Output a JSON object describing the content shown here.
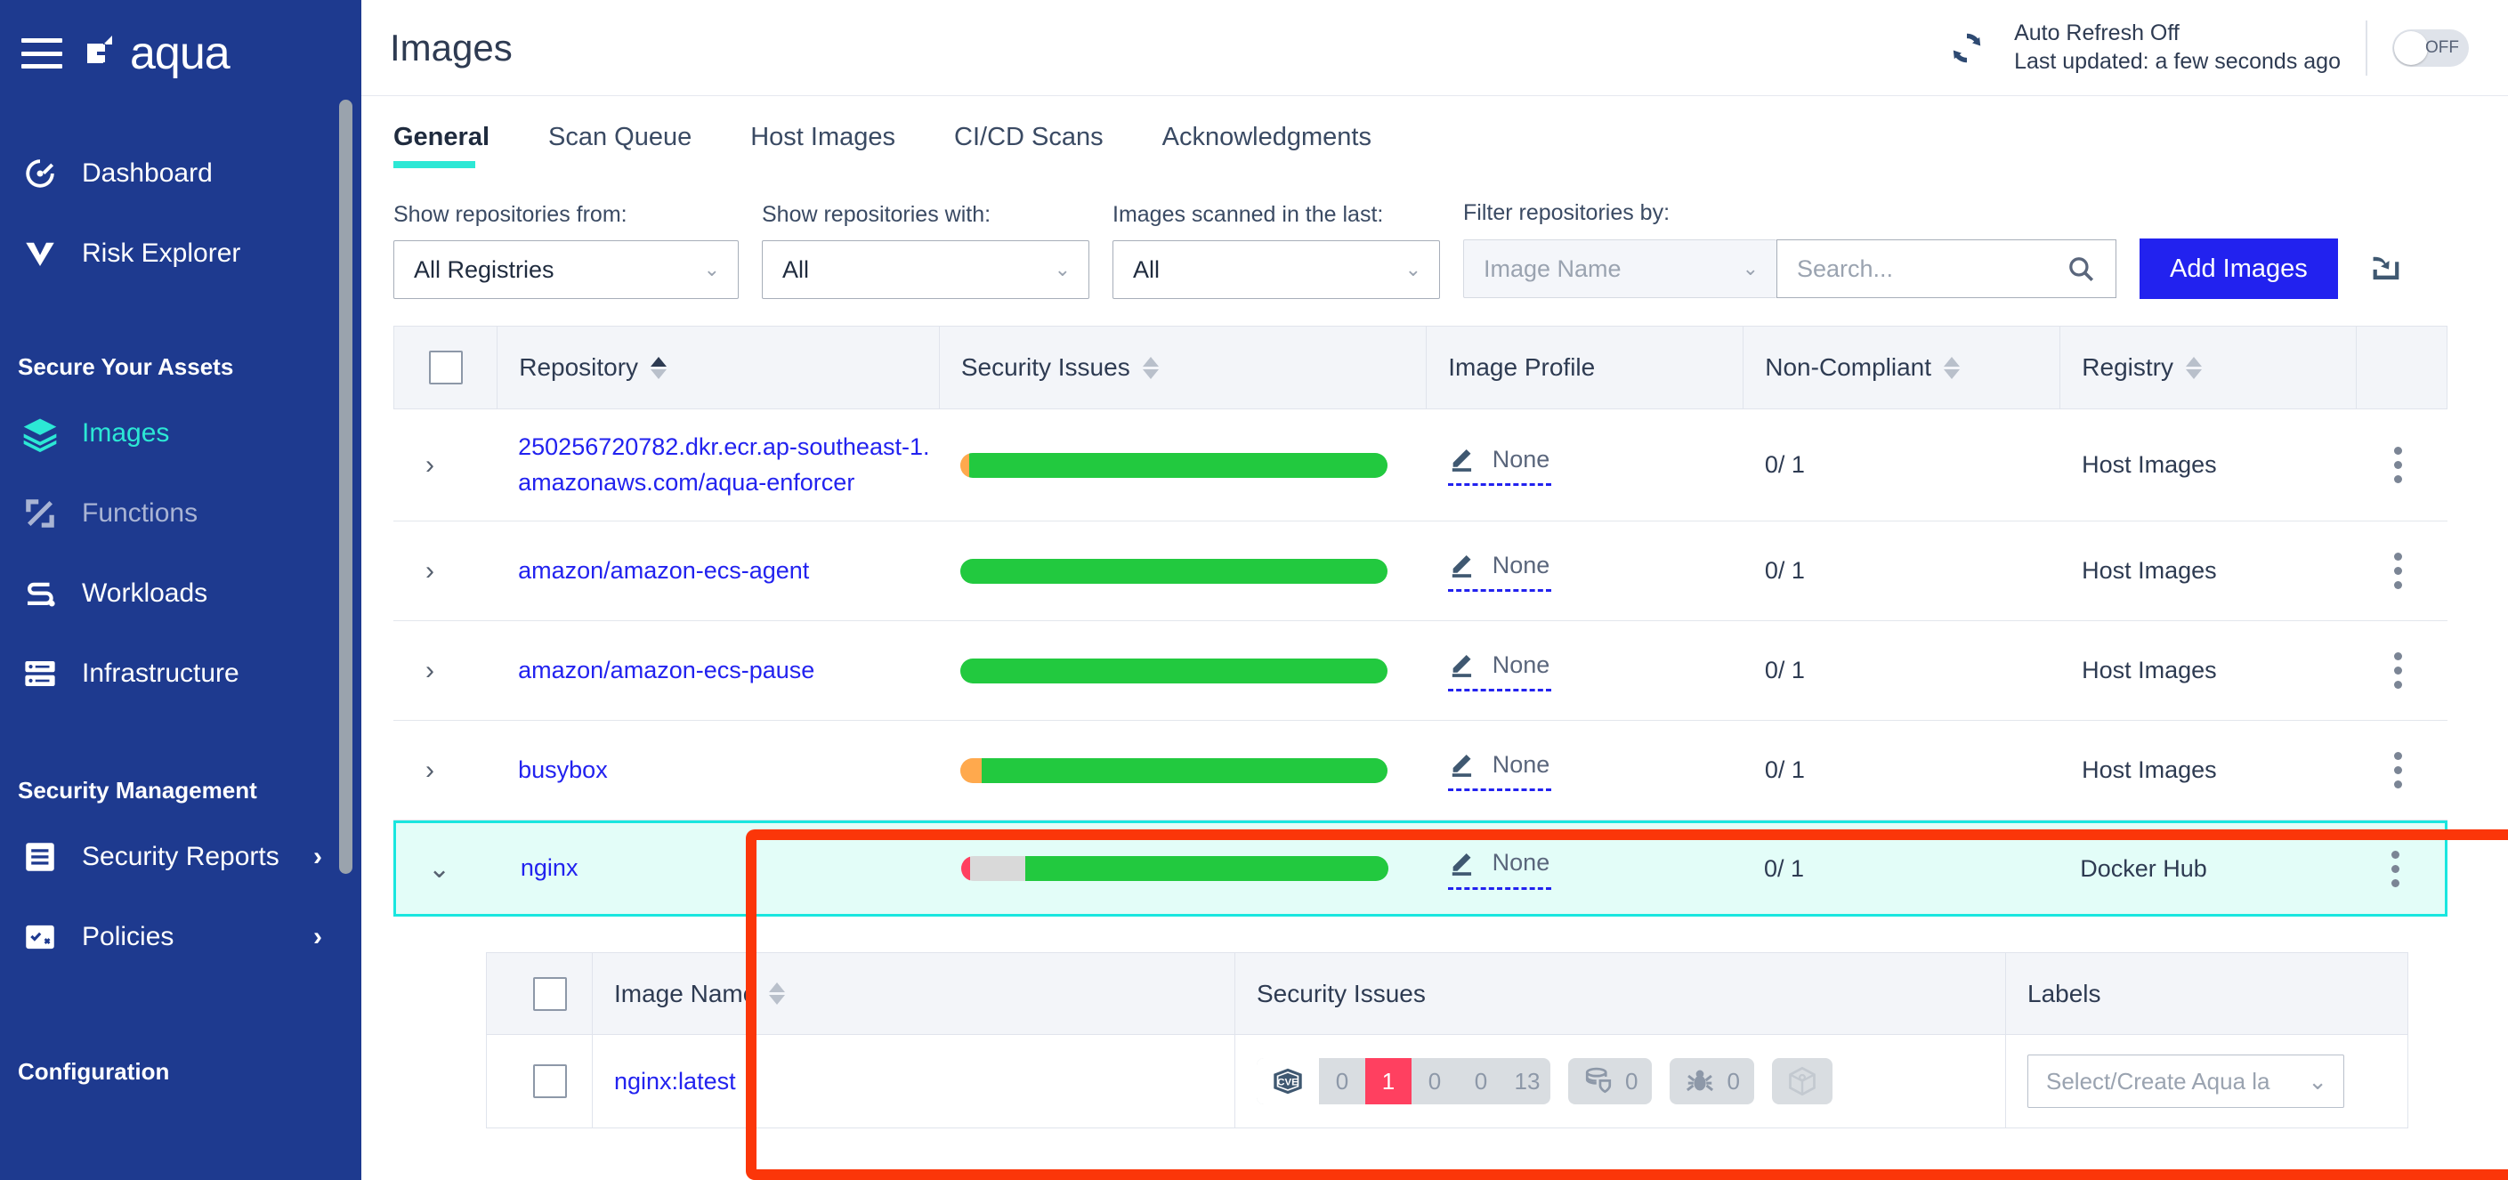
{
  "sidebar": {
    "brand": "aqua",
    "items": [
      {
        "label": "Dashboard",
        "icon": "dashboard-icon",
        "state": "normal"
      },
      {
        "label": "Risk Explorer",
        "icon": "risk-explorer-icon",
        "state": "normal"
      }
    ],
    "section_assets": "Secure Your Assets",
    "assets_items": [
      {
        "label": "Images",
        "icon": "images-icon",
        "state": "active"
      },
      {
        "label": "Functions",
        "icon": "functions-icon",
        "state": "dim"
      },
      {
        "label": "Workloads",
        "icon": "workloads-icon",
        "state": "normal"
      },
      {
        "label": "Infrastructure",
        "icon": "infrastructure-icon",
        "state": "normal"
      }
    ],
    "section_security": "Security Management",
    "security_items": [
      {
        "label": "Security Reports",
        "icon": "reports-icon",
        "chevron": "›"
      },
      {
        "label": "Policies",
        "icon": "policies-icon",
        "chevron": "›"
      }
    ],
    "section_configuration": "Configuration"
  },
  "header": {
    "title": "Images",
    "refresh_status": "Auto Refresh Off",
    "last_updated": "Last updated: a few seconds ago",
    "toggle_label": "OFF"
  },
  "tabs": [
    {
      "label": "General",
      "active": true
    },
    {
      "label": "Scan Queue",
      "active": false
    },
    {
      "label": "Host Images",
      "active": false
    },
    {
      "label": "CI/CD Scans",
      "active": false
    },
    {
      "label": "Acknowledgments",
      "active": false
    }
  ],
  "filters": {
    "registries_label": "Show repositories from:",
    "registries_value": "All Registries",
    "with_label": "Show repositories with:",
    "with_value": "All",
    "scanned_label": "Images scanned in the last:",
    "scanned_value": "All",
    "filterby_label": "Filter repositories by:",
    "filterby_value": "Image Name",
    "search_placeholder": "Search...",
    "add_images_label": "Add Images"
  },
  "table": {
    "columns": [
      "Repository",
      "Security Issues",
      "Image Profile",
      "Non-Compliant",
      "Registry"
    ],
    "rows": [
      {
        "repository": "250256720782.dkr.ecr.ap-southeast-1.amazonaws.com/aqua-enforcer",
        "profile": "None",
        "non_compliant": "0/ 1",
        "registry": "Host Images",
        "bar": [
          {
            "color": "#ffa94d",
            "pct": 2
          },
          {
            "color": "#22c93f",
            "pct": 98
          }
        ],
        "expanded": false
      },
      {
        "repository": "amazon/amazon-ecs-agent",
        "profile": "None",
        "non_compliant": "0/ 1",
        "registry": "Host Images",
        "bar": [
          {
            "color": "#22c93f",
            "pct": 100
          }
        ],
        "expanded": false
      },
      {
        "repository": "amazon/amazon-ecs-pause",
        "profile": "None",
        "non_compliant": "0/ 1",
        "registry": "Host Images",
        "bar": [
          {
            "color": "#22c93f",
            "pct": 100
          }
        ],
        "expanded": false
      },
      {
        "repository": "busybox",
        "profile": "None",
        "non_compliant": "0/ 1",
        "registry": "Host Images",
        "bar": [
          {
            "color": "#ffa94d",
            "pct": 5
          },
          {
            "color": "#22c93f",
            "pct": 95
          }
        ],
        "expanded": false
      },
      {
        "repository": "nginx",
        "profile": "None",
        "non_compliant": "0/ 1",
        "registry": "Docker Hub",
        "bar": [
          {
            "color": "#ff4060",
            "pct": 2
          },
          {
            "color": "#d9d9d9",
            "pct": 13
          },
          {
            "color": "#22c93f",
            "pct": 85
          }
        ],
        "expanded": true,
        "selected": true
      }
    ]
  },
  "subtable": {
    "columns": [
      "Image Name",
      "Security Issues",
      "Labels"
    ],
    "rows": [
      {
        "image_name": "nginx:latest",
        "cve_counts": [
          "0",
          "1",
          "0",
          "0",
          "13"
        ],
        "cve_highlight_index": 1,
        "vuln_db_count": "0",
        "malware_count": "0",
        "labels_placeholder": "Select/Create Aqua la"
      }
    ]
  },
  "colors": {
    "sidebar": "#1e3a8f",
    "accent_teal": "#2ce8d5",
    "link_blue": "#2222ef",
    "annotation_red": "#fb3609",
    "bar_green": "#22c93f",
    "critical_red": "#ff4060"
  }
}
